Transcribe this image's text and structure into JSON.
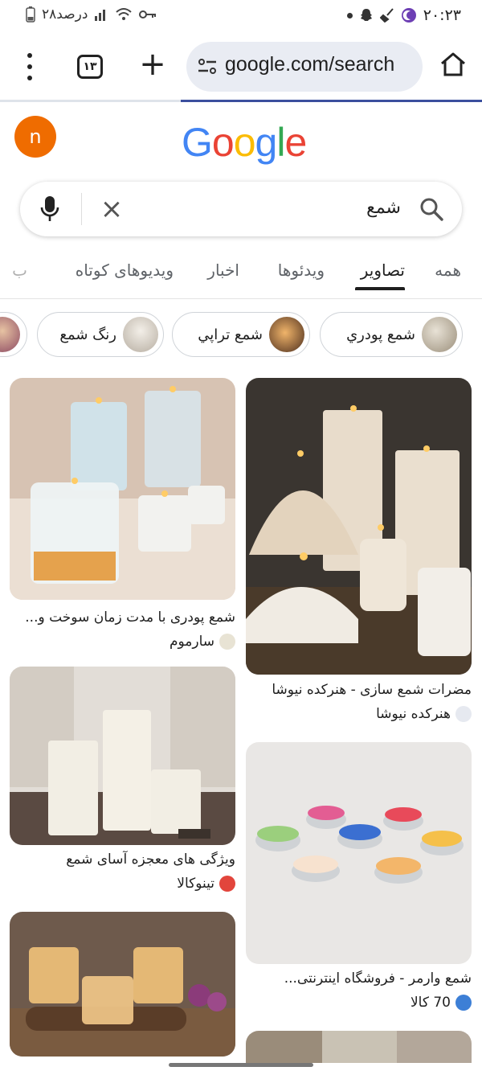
{
  "status_bar": {
    "time": "۲۰:۲۳",
    "battery_text": "۲۸درصد"
  },
  "browser": {
    "tab_count": "۱۳",
    "new_tab_symbol": "+",
    "url": "google.com/search",
    "progress_fraction": 0.625
  },
  "account": {
    "initial": "n"
  },
  "logo": {
    "letters": [
      "G",
      "o",
      "o",
      "g",
      "l",
      "e"
    ],
    "colors": [
      "#4285f4",
      "#ea4335",
      "#fbbc05",
      "#4285f4",
      "#34a853",
      "#ea4335"
    ]
  },
  "search": {
    "query": "شمع",
    "clear_symbol": "×"
  },
  "tabs": [
    {
      "label": "همه"
    },
    {
      "label": "تصاویر"
    },
    {
      "label": "ویدئوها"
    },
    {
      "label": "اخبار"
    },
    {
      "label": "ویدیوهای کوتاه"
    },
    {
      "label": "ب"
    }
  ],
  "chips": [
    {
      "label": "شمع پودري"
    },
    {
      "label": "شمع تراپي"
    },
    {
      "label": "رنگ شمع"
    }
  ],
  "results": [
    {
      "title": "مضرات شمع سازی - هنرکده نیوشا",
      "source": "هنرکده نیوشا"
    },
    {
      "title": "شمع پودری با مدت زمان سوخت و...",
      "source": "سارموم"
    },
    {
      "title": "ویژگی های معجزه آسای شمع",
      "source": "تینوکالا"
    },
    {
      "title": "شمع وارمر - فروشگاه اینترنتی...",
      "source": "70 کالا"
    }
  ],
  "colors": {
    "accent": "#3b4f9e",
    "avatar": "#ef6c00"
  }
}
